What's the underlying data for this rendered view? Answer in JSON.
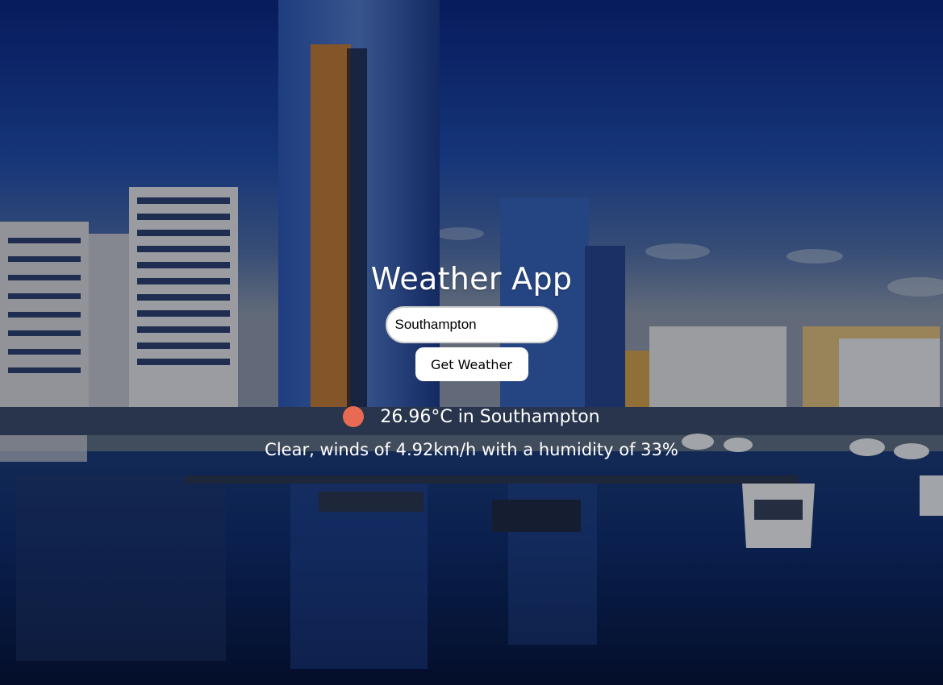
{
  "app": {
    "title": "Weather App"
  },
  "search": {
    "value": "Southampton",
    "button_label": "Get Weather"
  },
  "result": {
    "temperature_line": "26.96°C in Southampton",
    "description_line": "Clear, winds of 4.92km/h with a humidity of 33%",
    "icon": "weather-dot-icon",
    "icon_color": "#e96a52"
  },
  "colors": {
    "sky": "#163d9c",
    "water": "#0c2a5e",
    "text": "#ffffff"
  }
}
